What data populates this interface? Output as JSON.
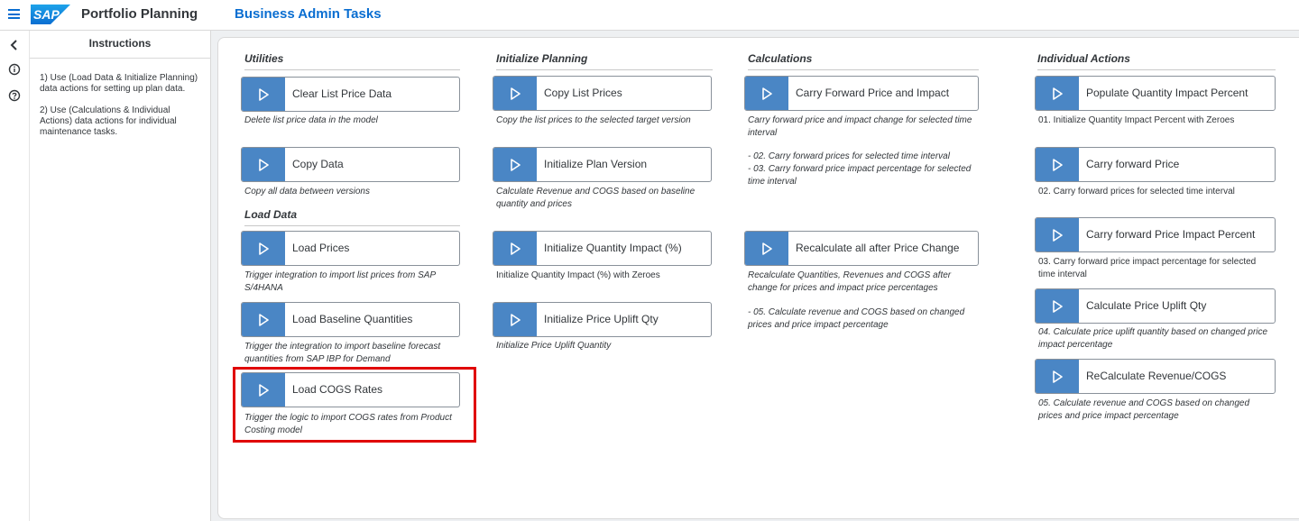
{
  "shell": {
    "app_title": "Portfolio Planning",
    "page_title": "Business Admin Tasks",
    "logo_text": "SAP"
  },
  "instructions": {
    "title": "Instructions",
    "paragraphs": [
      "1) Use (Load Data & Initialize Planning) data actions for setting up plan data.",
      "2) Use (Calculations & Individual Actions) data actions for individual maintenance tasks."
    ]
  },
  "sections": {
    "utilities": "Utilities",
    "load_data": "Load Data",
    "initialize_planning": "Initialize Planning",
    "calculations": "Calculations",
    "individual_actions": "Individual Actions"
  },
  "tiles": {
    "clear_list_price": {
      "label": "Clear List Price Data",
      "desc": "Delete list price data in the model"
    },
    "copy_data": {
      "label": "Copy Data",
      "desc": "Copy all data between versions"
    },
    "load_prices": {
      "label": "Load Prices",
      "desc": "Trigger integration to import list prices from SAP S/4HANA"
    },
    "load_baseline": {
      "label": "Load Baseline Quantities",
      "desc": "Trigger the integration to import baseline forecast quantities from SAP IBP for Demand"
    },
    "load_cogs": {
      "label": "Load COGS Rates",
      "desc": "Trigger the logic to import COGS rates from Product Costing model"
    },
    "copy_list_prices": {
      "label": "Copy List Prices",
      "desc": "Copy the list prices to the selected target version"
    },
    "init_plan_version": {
      "label": "Initialize Plan Version",
      "desc": "Calculate Revenue and COGS based on baseline quantity and prices"
    },
    "init_qty_impact": {
      "label": "Initialize Quantity Impact (%)",
      "desc": "Initialize Quantity Impact (%) with Zeroes"
    },
    "init_price_uplift": {
      "label": "Initialize Price Uplift Qty",
      "desc": "Initialize Price Uplift Quantity"
    },
    "carry_forward_price_impact": {
      "label": "Carry Forward Price and Impact",
      "desc": "Carry forward price and impact change for selected time interval",
      "desc2": "- 02. Carry forward prices for selected time interval",
      "desc3": "- 03. Carry forward price impact percentage for selected time interval"
    },
    "recalc_all": {
      "label": "Recalculate all after Price Change",
      "desc": "Recalculate Quantities, Revenues and COGS after change for prices and impact price percentages",
      "desc2": "- 05. Calculate revenue and COGS based on changed prices and price impact percentage"
    },
    "populate_qty_impact": {
      "label": "Populate Quantity Impact Percent",
      "desc": "01. Initialize Quantity Impact Percent with Zeroes"
    },
    "carry_forward_price": {
      "label": "Carry forward Price",
      "desc": "02. Carry forward prices for selected time interval"
    },
    "carry_forward_price_impact_pct": {
      "label": "Carry forward Price Impact Percent",
      "desc": "03. Carry forward price impact percentage for selected time interval"
    },
    "calc_price_uplift": {
      "label": "Calculate Price Uplift Qty",
      "desc": "04. Calculate price uplift quantity based on changed price impact percentage"
    },
    "recalc_revenue_cogs": {
      "label": "ReCalculate Revenue/COGS",
      "desc": "05. Calculate revenue and COGS based on changed prices and price impact percentage"
    }
  },
  "colors": {
    "accent": "#0a6ed1",
    "play_button": "#4a86c5",
    "highlight": "#e00000"
  },
  "icons": {
    "menu": "hamburger-menu-icon",
    "back": "chevron-left-icon",
    "info": "info-icon",
    "help": "question-mark-icon",
    "play": "play-icon"
  }
}
